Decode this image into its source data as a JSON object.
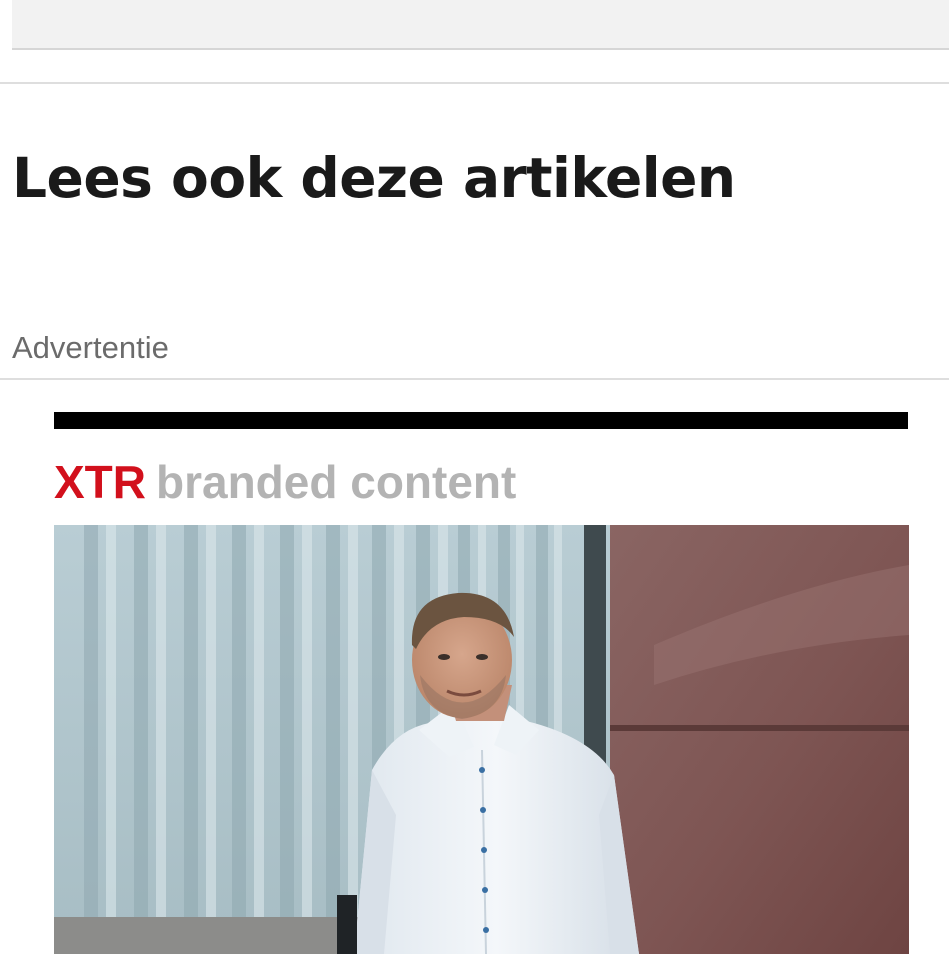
{
  "top_box": {
    "text": ""
  },
  "section": {
    "heading": "Lees ook deze artikelen"
  },
  "ad": {
    "label": "Advertentie",
    "brand": {
      "name": "XTR",
      "suffix": "branded content"
    },
    "image": {
      "subject": "man-in-white-shirt-photo"
    }
  },
  "colors": {
    "brand_red": "#d2101c",
    "brand_grey": "#b3b3b3",
    "heading": "#1a1a1a",
    "label": "#6b6b6b",
    "divider": "#dedede"
  }
}
